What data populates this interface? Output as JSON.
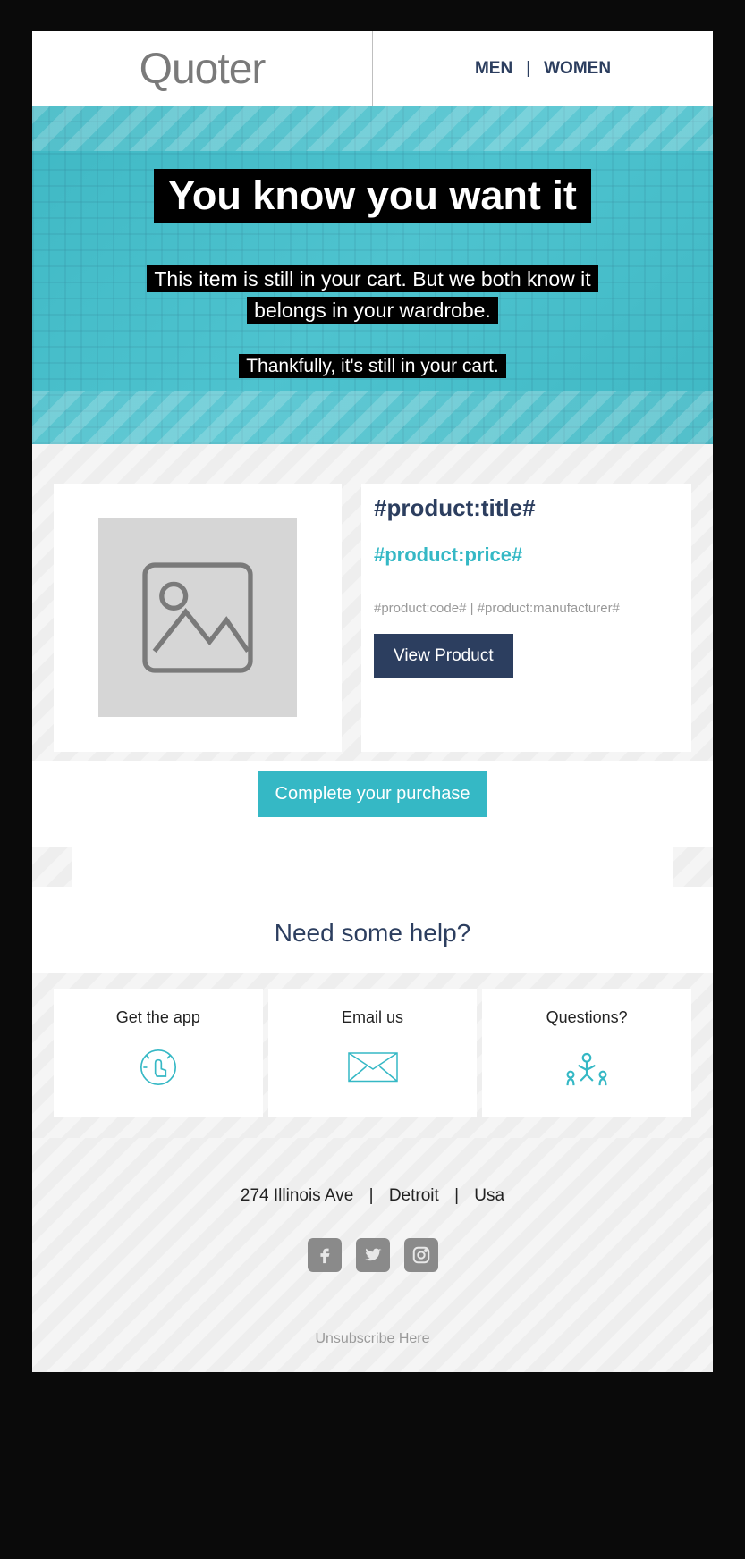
{
  "header": {
    "logo": "Quoter",
    "nav": {
      "men": "MEN",
      "women": "WOMEN",
      "sep": "|"
    }
  },
  "hero": {
    "headline": "You know you want it",
    "body1": "This item is still in your cart. But we both know it",
    "body2": "belongs in your wardrobe.",
    "body3": "Thankfully, it's still in your cart."
  },
  "product": {
    "title": "#product:title#",
    "price": "#product:price#",
    "meta": "#product:code# | #product:manufacturer#",
    "view_label": "View Product"
  },
  "cta": {
    "complete": "Complete your purchase"
  },
  "help": {
    "title": "Need some help?",
    "cards": [
      {
        "label": "Get the app"
      },
      {
        "label": "Email us"
      },
      {
        "label": "Questions?"
      }
    ]
  },
  "footer": {
    "address_street": "274 Illinois Ave",
    "address_city": "Detroit",
    "address_country": "Usa",
    "sep": "|",
    "unsubscribe": "Unsubscribe Here"
  }
}
